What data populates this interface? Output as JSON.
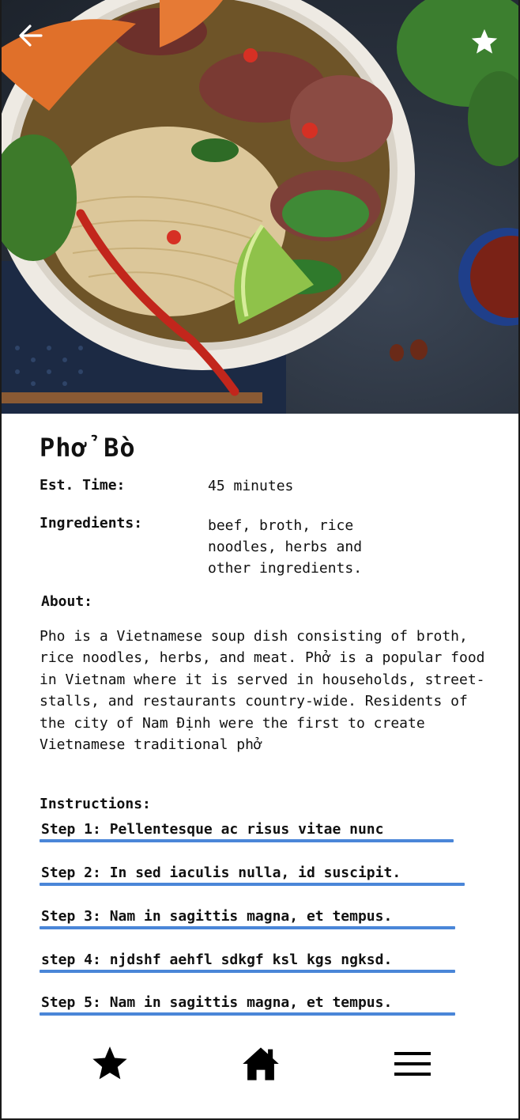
{
  "recipe": {
    "title": "Phở Bò",
    "time_label": "Est. Time:",
    "time_value": "45 minutes",
    "ingredients_label": "Ingredients:",
    "ingredients_value": "beef, broth, rice noodles, herbs and other ingredients.",
    "about_label": "About:",
    "about_text": "Pho is a Vietnamese soup dish consisting of broth, rice noodles, herbs, and meat. Phở is a popular food in Vietnam where it is served in households, street-stalls, and restaurants country-wide. Residents of the city of Nam Định were the first to create Vietnamese traditional phở",
    "instructions_label": "Instructions:",
    "steps": [
      "Step 1: Pellentesque ac risus vitae nunc",
      "Step 2: In sed iaculis nulla, id suscipit.",
      "Step 3: Nam in sagittis magna, et tempus.",
      "step 4: njdshf aehfl sdkgf ksl kgs ngksd.",
      "Step 5: Nam in sagittis magna, et tempus."
    ]
  },
  "header": {
    "back_icon": "arrow-left-icon",
    "favorite_icon": "star-icon"
  },
  "bottom_nav": {
    "items": [
      {
        "icon": "star-icon",
        "name": "favorites"
      },
      {
        "icon": "home-icon",
        "name": "home"
      },
      {
        "icon": "hamburger-menu-icon",
        "name": "menu"
      }
    ]
  },
  "colors": {
    "step_underline": "#4a86d8",
    "text": "#111111",
    "background": "#ffffff"
  }
}
